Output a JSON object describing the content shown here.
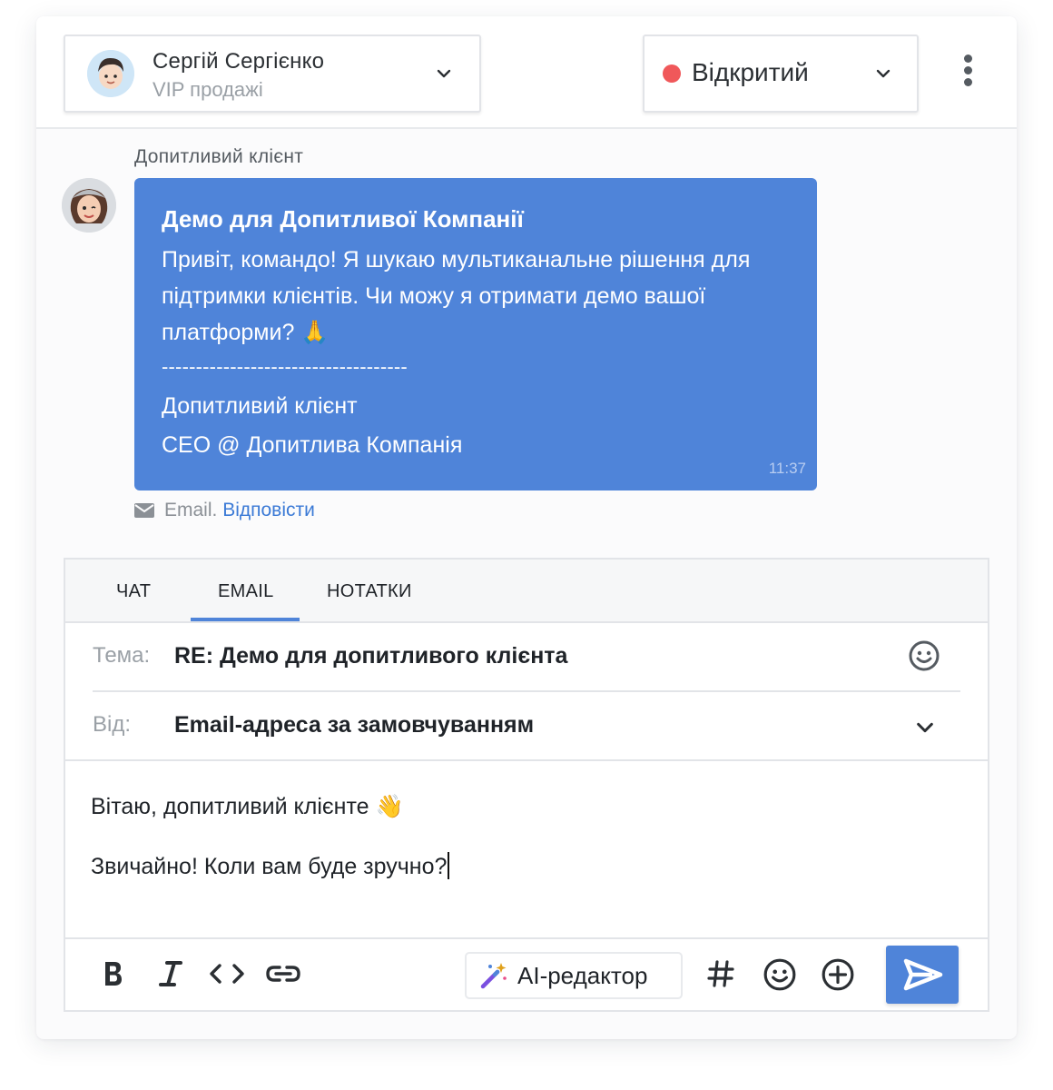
{
  "header": {
    "assignee_name": "Сергій Сергієнко",
    "assignee_team": "VIP продажі",
    "status_label": "Відкритий",
    "status_color": "#f0585a",
    "menu_icon": "kebab-menu-icon"
  },
  "message": {
    "sender": "Допитливий клієнт",
    "subject": "Демо для Допитливої Компанії",
    "body": "Привіт, командо! Я шукаю мультиканальне рішення для підтримки клієнтів. Чи можу я отримати демо вашої платформи? 🙏",
    "divider": "------------------------------------",
    "signature_name": "Допитливий клієнт",
    "signature_title": "CEO @ Допитлива Компанія",
    "time": "11:37",
    "channel": "Email.",
    "reply_link": "Відповісти",
    "bubble_color": "#4f84d9"
  },
  "composer": {
    "tabs": [
      {
        "label": "ЧАТ"
      },
      {
        "label": "EMAIL"
      },
      {
        "label": "НОТАТКИ"
      }
    ],
    "active_tab": "EMAIL",
    "subject_label": "Тема:",
    "subject_value": "RE: Демо для допитливого клієнта",
    "from_label": "Від:",
    "from_value": "Email-адреса за замовчуванням",
    "body_line1": "Вітаю, допитливий клієнте 👋",
    "body_line2": "Звичайно! Коли вам буде зручно?",
    "ai_button_label": "AI-редактор",
    "toolbar_icons": [
      "bold-icon",
      "italic-icon",
      "code-icon",
      "link-icon",
      "magic-wand-icon",
      "hashtag-icon",
      "emoji-icon",
      "add-circle-icon",
      "send-icon"
    ]
  }
}
